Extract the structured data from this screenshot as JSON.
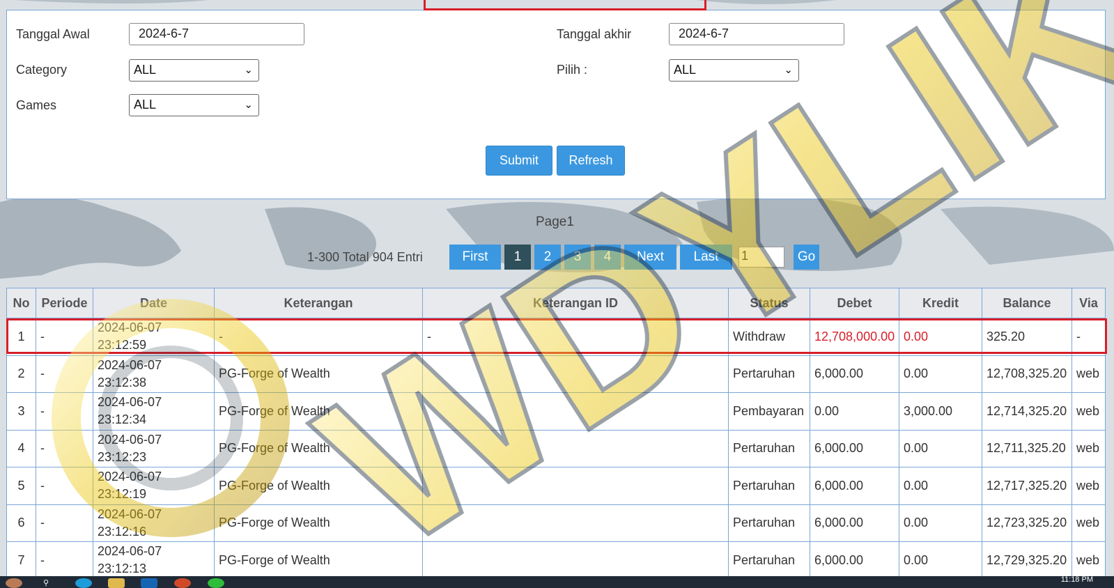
{
  "filter": {
    "tanggal_awal_label": "Tanggal Awal",
    "tanggal_awal_value": "2024-6-7",
    "tanggal_akhir_label": "Tanggal akhir",
    "tanggal_akhir_value": "2024-6-7",
    "category_label": "Category",
    "category_value": "ALL",
    "pilih_label": "Pilih :",
    "pilih_value": "ALL",
    "games_label": "Games",
    "games_value": "ALL",
    "submit_label": "Submit",
    "refresh_label": "Refresh"
  },
  "pagination": {
    "page_label": "Page1",
    "entries_text": "1-300 Total 904 Entri",
    "first_label": "First",
    "pages": [
      "1",
      "2",
      "3",
      "4"
    ],
    "next_label": "Next",
    "last_label": "Last",
    "goto_value": "1",
    "go_label": "Go"
  },
  "table": {
    "headers": [
      "No",
      "Periode",
      "Date",
      "Keterangan",
      "Keterangan ID",
      "Status",
      "Debet",
      "Kredit",
      "Balance",
      "Via"
    ],
    "rows": [
      {
        "no": "1",
        "periode": "-",
        "date": "2024-06-07",
        "time": "23:12:59",
        "keterangan": "-",
        "keterangan_id": "-",
        "status": "Withdraw",
        "debet": "12,708,000.00",
        "kredit": "0.00",
        "balance": "325.20",
        "via": "-"
      },
      {
        "no": "2",
        "periode": "-",
        "date": "2024-06-07",
        "time": "23:12:38",
        "keterangan": "PG-Forge of Wealth",
        "keterangan_id": "",
        "status": "Pertaruhan",
        "debet": "6,000.00",
        "kredit": "0.00",
        "balance": "12,708,325.20",
        "via": "web"
      },
      {
        "no": "3",
        "periode": "-",
        "date": "2024-06-07",
        "time": "23:12:34",
        "keterangan": "PG-Forge of Wealth",
        "keterangan_id": "",
        "status": "Pembayaran",
        "debet": "0.00",
        "kredit": "3,000.00",
        "balance": "12,714,325.20",
        "via": "web"
      },
      {
        "no": "4",
        "periode": "-",
        "date": "2024-06-07",
        "time": "23:12:23",
        "keterangan": "PG-Forge of Wealth",
        "keterangan_id": "",
        "status": "Pertaruhan",
        "debet": "6,000.00",
        "kredit": "0.00",
        "balance": "12,711,325.20",
        "via": "web"
      },
      {
        "no": "5",
        "periode": "-",
        "date": "2024-06-07",
        "time": "23:12:19",
        "keterangan": "PG-Forge of Wealth",
        "keterangan_id": "",
        "status": "Pertaruhan",
        "debet": "6,000.00",
        "kredit": "0.00",
        "balance": "12,717,325.20",
        "via": "web"
      },
      {
        "no": "6",
        "periode": "-",
        "date": "2024-06-07",
        "time": "23:12:16",
        "keterangan": "PG-Forge of Wealth",
        "keterangan_id": "",
        "status": "Pertaruhan",
        "debet": "6,000.00",
        "kredit": "0.00",
        "balance": "12,723,325.20",
        "via": "web"
      },
      {
        "no": "7",
        "periode": "-",
        "date": "2024-06-07",
        "time": "23:12:13",
        "keterangan": "PG-Forge of Wealth",
        "keterangan_id": "",
        "status": "Pertaruhan",
        "debet": "6,000.00",
        "kredit": "0.00",
        "balance": "12,729,325.20",
        "via": "web"
      }
    ]
  },
  "taskbar": {
    "clock": "11:18 PM"
  },
  "watermark": {
    "text": "WDYLIK"
  },
  "colors": {
    "accent_blue": "#3b98e0",
    "active_page": "#2f4f5a",
    "highlight_red": "#d81e2a",
    "border_blue": "#7aa6d6"
  }
}
